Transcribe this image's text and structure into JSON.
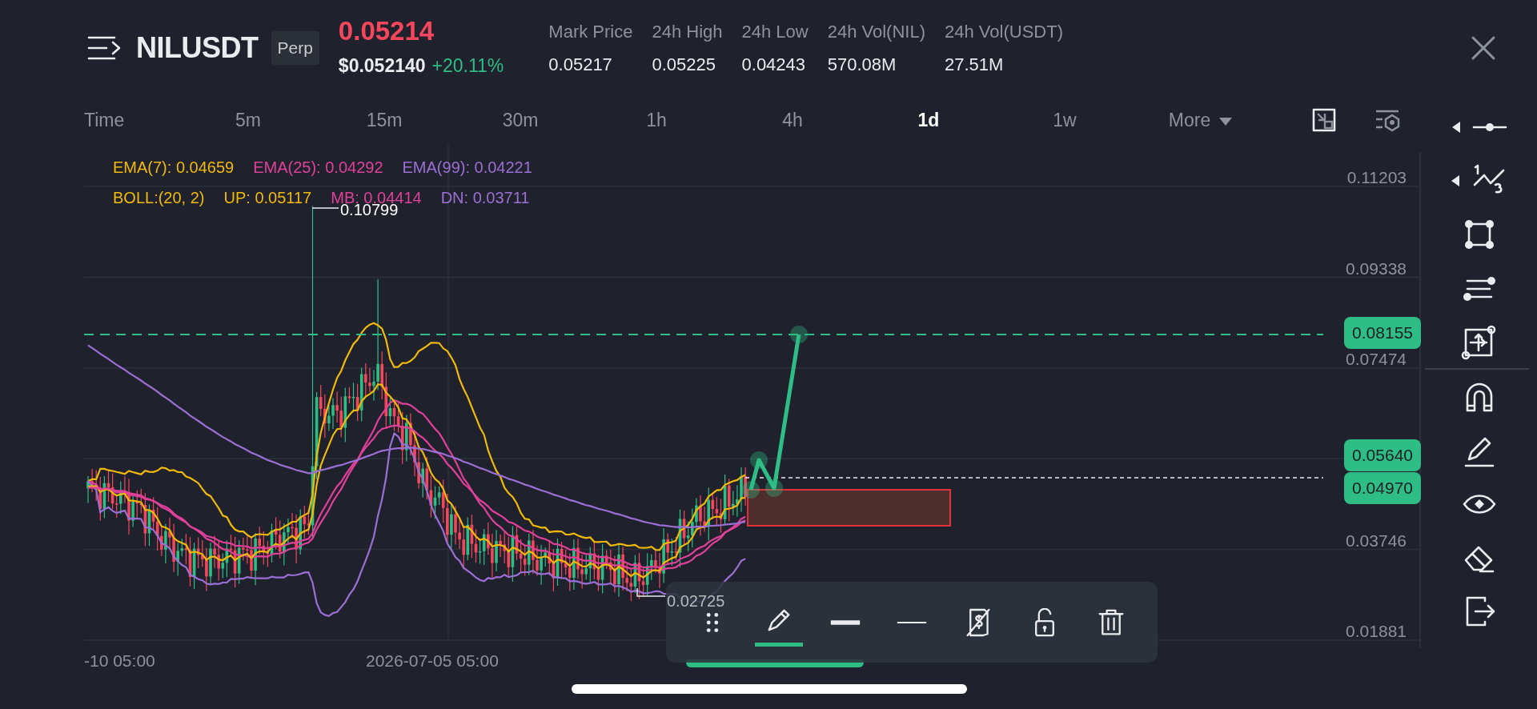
{
  "header": {
    "symbol": "NILUSDT",
    "contract_type": "Perp",
    "last_price": "0.05214",
    "usd_price": "$0.052140",
    "change": "+20.11%"
  },
  "stats": [
    {
      "label": "Mark Price",
      "value": "0.05217"
    },
    {
      "label": "24h High",
      "value": "0.05225"
    },
    {
      "label": "24h Low",
      "value": "0.04243"
    },
    {
      "label": "24h Vol(NIL)",
      "value": "570.08M"
    },
    {
      "label": "24h Vol(USDT)",
      "value": "27.51M"
    }
  ],
  "intervals": [
    {
      "label": "Time",
      "selected": false
    },
    {
      "label": "5m",
      "selected": false
    },
    {
      "label": "15m",
      "selected": false
    },
    {
      "label": "30m",
      "selected": false
    },
    {
      "label": "1h",
      "selected": false
    },
    {
      "label": "4h",
      "selected": false
    },
    {
      "label": "1d",
      "selected": true
    },
    {
      "label": "1w",
      "selected": false
    },
    {
      "label": "More",
      "selected": false
    }
  ],
  "indicators": [
    [
      {
        "text": "EMA(7): 0.04659",
        "color": "#f0b90b"
      },
      {
        "text": "EMA(25): 0.04292",
        "color": "#e0409a"
      },
      {
        "text": "EMA(99): 0.04221",
        "color": "#9b6fd6"
      }
    ],
    [
      {
        "text": "BOLL:(20, 2)",
        "color": "#f0b90b"
      },
      {
        "text": "UP: 0.05117",
        "color": "#f0b90b"
      },
      {
        "text": "MB: 0.04414",
        "color": "#e0409a"
      },
      {
        "text": "DN: 0.03711",
        "color": "#9b6fd6"
      }
    ]
  ],
  "price_axis": {
    "ticks": [
      "0.11203",
      "0.09338",
      "0.07474",
      "0.03746",
      "0.01881"
    ],
    "badges": [
      {
        "value": "0.08155"
      },
      {
        "value": "0.05640"
      },
      {
        "value": "0.04970"
      }
    ]
  },
  "chart_labels": {
    "high": "0.10799",
    "low": "0.02725"
  },
  "time_axis": [
    "-10 05:00",
    "2026-07-05 05:00"
  ],
  "drawing_tools": [
    {
      "kind": "drag",
      "selected": false
    },
    {
      "kind": "pencil",
      "selected": true
    },
    {
      "kind": "thick",
      "selected": false
    },
    {
      "kind": "thin",
      "selected": false
    },
    {
      "kind": "noprice",
      "selected": false
    },
    {
      "kind": "lock",
      "selected": false
    },
    {
      "kind": "trash",
      "selected": false
    }
  ]
}
